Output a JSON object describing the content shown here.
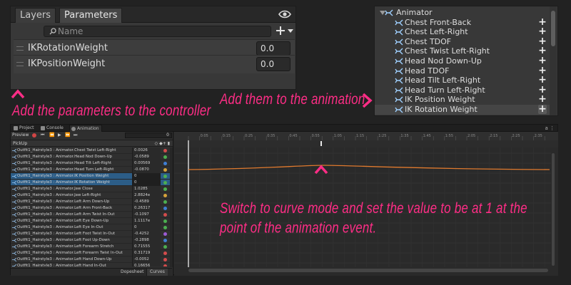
{
  "params_panel": {
    "tabs": [
      "Layers",
      "Parameters"
    ],
    "search_placeholder": "Name",
    "parameters": [
      {
        "name": "IKRotationWeight",
        "value": "0.0"
      },
      {
        "name": "IKPositionWeight",
        "value": "0.0"
      }
    ]
  },
  "annotations": {
    "params": "Add the parameters to the controller",
    "animation": "Add them to the animation",
    "curve": "Switch to curve mode and set the value to be at 1 at the point of the animation event."
  },
  "property_list": {
    "root": "Animator",
    "items": [
      "Chest Front-Back",
      "Chest Left-Right",
      "Chest TDOF",
      "Chest Twist Left-Right",
      "Head Nod Down-Up",
      "Head TDOF",
      "Head Tilt Left-Right",
      "Head Turn Left-Right",
      "IK Position Weight",
      "IK Rotation Weight"
    ]
  },
  "animation_window": {
    "tabs": [
      "Project",
      "Console",
      "Animation"
    ],
    "preview_label": "Preview",
    "frame_value": "0",
    "clip_name": "PickUp",
    "tracks": [
      {
        "name": "Outfit1_Hairstyle3 : Animator.Chest Twist Left-Right",
        "value": "0.0026",
        "dot": "#d44c4c"
      },
      {
        "name": "Outfit1_Hairstyle3 : Animator.Head Nod Down-Up",
        "value": "-0.0589",
        "dot": "#4caf50"
      },
      {
        "name": "Outfit1_Hairstyle3 : Animator.Head Tilt Left-Right",
        "value": "0.00569",
        "dot": "#3f7fd4"
      },
      {
        "name": "Outfit1_Hairstyle3 : Animator.Head Turn Left-Right",
        "value": "-0.0870",
        "dot": "#d6a23a"
      },
      {
        "name": "Outfit1_Hairstyle3 : Animator.IK Position Weight",
        "value": "0",
        "dot": "#4caf50",
        "selected": true
      },
      {
        "name": "Outfit1_Hairstyle3 : Animator.IK Rotation Weight",
        "value": "0",
        "dot": "#4caf50",
        "selected": true
      },
      {
        "name": "Outfit1_Hairstyle3 : Animator.Jaw Close",
        "value": "1.0285",
        "dot": "#4caf50"
      },
      {
        "name": "Outfit1_Hairstyle3 : Animator.Jaw Left-Right",
        "value": "2.8824e",
        "dot": "#d6a23a"
      },
      {
        "name": "Outfit1_Hairstyle3 : Animator.Left Arm Down-Up",
        "value": "-0.4589",
        "dot": "#4caf50"
      },
      {
        "name": "Outfit1_Hairstyle3 : Animator.Left Arm Front-Back",
        "value": "0.26317",
        "dot": "#3f7fd4"
      },
      {
        "name": "Outfit1_Hairstyle3 : Animator.Left Arm Twist In-Out",
        "value": "-0.1097",
        "dot": "#d44c4c"
      },
      {
        "name": "Outfit1_Hairstyle3 : Animator.Left Eye Down-Up",
        "value": "1.1117e",
        "dot": "#4caf50"
      },
      {
        "name": "Outfit1_Hairstyle3 : Animator.Left Eye In-Out",
        "value": "0",
        "dot": "#4caf50"
      },
      {
        "name": "Outfit1_Hairstyle3 : Animator.Left Foot Twist In-Out",
        "value": "-0.4252",
        "dot": "#9c5bd4"
      },
      {
        "name": "Outfit1_Hairstyle3 : Animator.Left Foot Up-Down",
        "value": "-0.2898",
        "dot": "#3f7fd4"
      },
      {
        "name": "Outfit1_Hairstyle3 : Animator.Left Forearm Stretch",
        "value": "0.71555",
        "dot": "#4caf50"
      },
      {
        "name": "Outfit1_Hairstyle3 : Animator.Left Forearm Twist In-Out",
        "value": "0.31719",
        "dot": "#d44c4c"
      },
      {
        "name": "Outfit1_Hairstyle3 : Animator.Left Hand Down-Up",
        "value": "-0.0052",
        "dot": "#d44c4c"
      },
      {
        "name": "Outfit1_Hairstyle3 : Animator.Left Hand In-Out",
        "value": "0.16656",
        "dot": "#d44c4c"
      }
    ],
    "mode_tabs": [
      "Dopesheet",
      "Curves"
    ],
    "ruler_labels": [
      "0:00",
      "0:05",
      "0:10",
      "0:15",
      "0:20",
      "0:25",
      "0:30",
      "0:35",
      "0:40",
      "0:45",
      "0:50",
      "0:55",
      "1:00",
      "1:05",
      "1:10",
      "1:15",
      "1:20",
      "1:25",
      "1:30",
      "1:35",
      "1:40",
      "1:45",
      "1:50",
      "1:55",
      "2:00",
      "2:05",
      "2:10",
      "2:15",
      "2:20",
      "2:25",
      "2:30",
      "2:35",
      "2:40"
    ],
    "curve_color": "#e07a2e"
  },
  "colors": {
    "annotation": "#ff2d86",
    "selection": "#2c5d87"
  }
}
